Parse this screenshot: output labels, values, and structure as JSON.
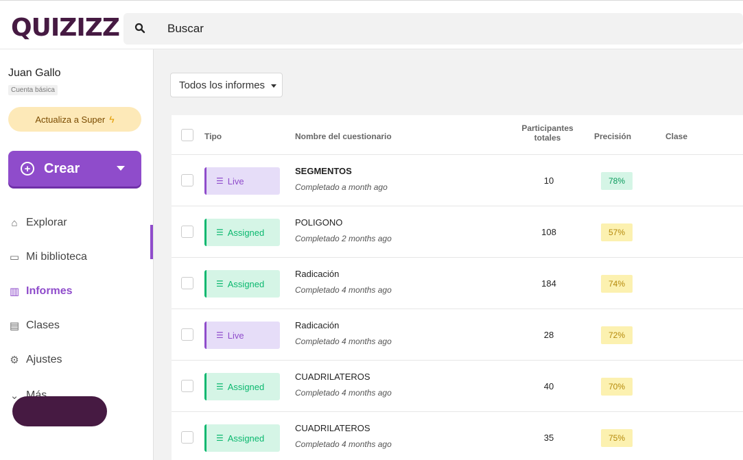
{
  "app": {
    "logo": "QUIZIZZ"
  },
  "search": {
    "placeholder": "Buscar"
  },
  "sidebar": {
    "user_name": "Juan Gallo",
    "plan": "Cuenta básica",
    "upgrade_label": "Actualiza a Super",
    "create_label": "Crear",
    "nav": [
      {
        "label": "Explorar",
        "icon": "explore-icon"
      },
      {
        "label": "Mi biblioteca",
        "icon": "folder-icon"
      },
      {
        "label": "Informes",
        "icon": "reports-icon",
        "active": true
      },
      {
        "label": "Clases",
        "icon": "classes-icon"
      },
      {
        "label": "Ajustes",
        "icon": "gear-icon"
      },
      {
        "label": "Más",
        "icon": "chevron-down-icon"
      }
    ]
  },
  "main": {
    "filter_label": "Todos los informes",
    "columns": {
      "type": "Tipo",
      "name": "Nombre del cuestionario",
      "participants": "Participantes totales",
      "accuracy": "Precisión",
      "class": "Clase"
    },
    "rows": [
      {
        "type": "Live",
        "name": "SEGMENTOS",
        "date": "Completado a month ago",
        "participants": "10",
        "accuracy": "78%"
      },
      {
        "type": "Assigned",
        "name": "POLIGONO",
        "date": "Completado 2 months ago",
        "participants": "108",
        "accuracy": "57%"
      },
      {
        "type": "Assigned",
        "name": "Radicación",
        "date": "Completado 4 months ago",
        "participants": "184",
        "accuracy": "74%"
      },
      {
        "type": "Live",
        "name": "Radicación",
        "date": "Completado 4 months ago",
        "participants": "28",
        "accuracy": "72%"
      },
      {
        "type": "Assigned",
        "name": "CUADRILATEROS",
        "date": "Completado 4 months ago",
        "participants": "40",
        "accuracy": "70%"
      },
      {
        "type": "Assigned",
        "name": "CUADRILATEROS",
        "date": "Completado 4 months ago",
        "participants": "35",
        "accuracy": "75%"
      }
    ]
  },
  "colors": {
    "brand": "#461a42",
    "accent": "#8f4ccb",
    "assigned": "#0bb86f",
    "good": "#d5f5e6",
    "mid": "#fcf1b0"
  }
}
